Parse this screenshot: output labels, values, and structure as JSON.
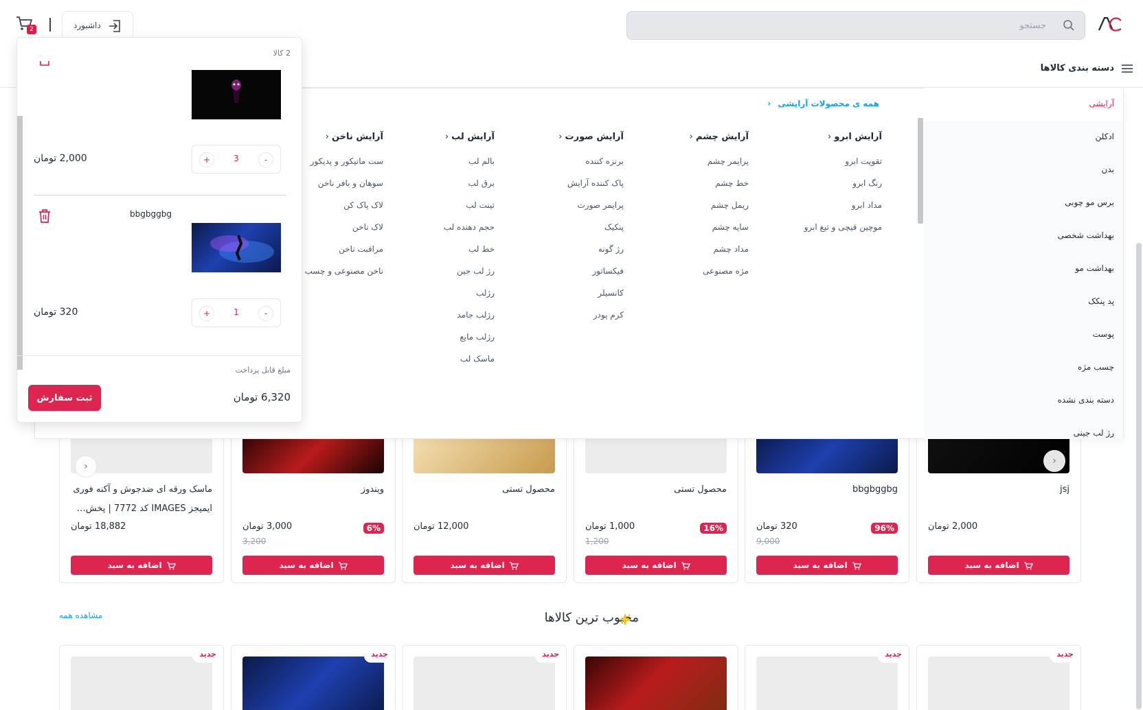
{
  "header": {
    "search_placeholder": "جستجو",
    "dashboard_label": "داشبورد",
    "cart_badge": "2",
    "categories_label": "دسته بندی کالاها"
  },
  "sidebar": {
    "items": [
      {
        "label": "آرایشی",
        "active": true
      },
      {
        "label": "ادکلن"
      },
      {
        "label": "بدن"
      },
      {
        "label": "برس مو چوبی"
      },
      {
        "label": "بهداشت شخصی"
      },
      {
        "label": "بهداشت مو"
      },
      {
        "label": "پد پنکک"
      },
      {
        "label": "پوست"
      },
      {
        "label": "چسب مژه"
      },
      {
        "label": "دسته بندی نشده"
      },
      {
        "label": "رژ لب جینی"
      }
    ]
  },
  "mega": {
    "all_products": "همه ی محصولات آرایشی",
    "columns": [
      {
        "title": "آرایش ابرو",
        "items": [
          "تقویت ابرو",
          "رنگ ابرو",
          "مداد ابرو",
          "موچین قیچی و تیغ ابرو"
        ]
      },
      {
        "title": "آرایش چشم",
        "items": [
          "پرایمر چشم",
          "خط چشم",
          "ریمل چشم",
          "سایه چشم",
          "مداد چشم",
          "مژه مصنوعی"
        ]
      },
      {
        "title": "آرایش صورت",
        "items": [
          "برنزه کننده",
          "پاک کننده آرایش",
          "پرایمر صورت",
          "پنکیک",
          "رژ گونه",
          "فیکساتور",
          "کانسیلر",
          "کرم پودر"
        ]
      },
      {
        "title": "آرایش لب",
        "items": [
          "بالم لب",
          "برق لب",
          "تینت لب",
          "حجم دهنده لب",
          "خط لب",
          "رژ لب جین",
          "رژلب",
          "رژلب جامد",
          "رژلب مایع",
          "ماسک لب"
        ]
      },
      {
        "title": "آرایش ناخن",
        "items": [
          "ست مانیکور و پدیکور",
          "سوهان و بافر ناخن",
          "لاک پاک کن",
          "لاک ناخن",
          "مراقبت ناخن",
          "ناخن مصنوعی و چسب"
        ]
      }
    ]
  },
  "cart": {
    "count_label": "2 کالا",
    "items": [
      {
        "name": "",
        "qty": "3",
        "price": "2,000 تومان"
      },
      {
        "name": "bbgbggbg",
        "qty": "1",
        "price": "320 تومان"
      }
    ],
    "plus": "+",
    "minus": "-",
    "payable_label": "مبلغ قابل پرداخت",
    "total": "6,320 تومان",
    "submit": "ثبت سفارش"
  },
  "products": [
    {
      "title": "jsj",
      "price": "2,000 تومان",
      "old": "",
      "discount": ""
    },
    {
      "title": "bbgbggbg",
      "price": "320 تومان",
      "old": "9,000",
      "discount": "96%"
    },
    {
      "title": "محصول تستی",
      "price": "1,000 تومان",
      "old": "1,200",
      "discount": "16%"
    },
    {
      "title": "محصول تستی",
      "price": "12,000 تومان",
      "old": "",
      "discount": ""
    },
    {
      "title": "ویندوز",
      "price": "3,000 تومان",
      "old": "3,200",
      "discount": "6%"
    },
    {
      "title": "ماسک ورقه ای ضدجوش و آکنه فوری ایمیجز IMAGES کد 7772 | پخش…",
      "price": "18,882 تومان",
      "old": "",
      "discount": ""
    }
  ],
  "add_to_cart": "اضافه به سبد",
  "popular": {
    "title": "محبوب ترین کالاها",
    "view_all": "مشاهده همه",
    "new_badge": "جدید"
  },
  "colors": {
    "accent": "#dc2650",
    "link": "#0ea5e9"
  }
}
